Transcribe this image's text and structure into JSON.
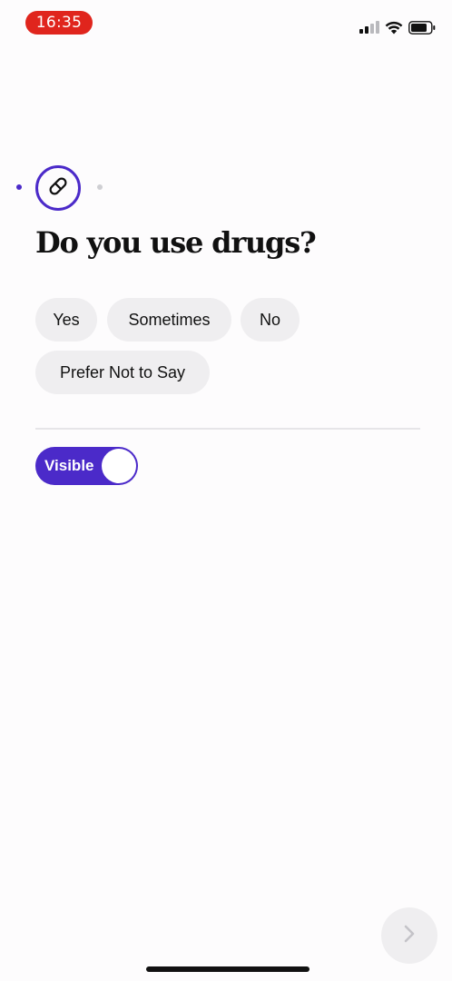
{
  "status_bar": {
    "time": "16:35",
    "time_pill_color": "#e0251d",
    "icons": [
      "cellular-signal-icon",
      "wifi-icon",
      "battery-icon"
    ]
  },
  "progress": {
    "current_step_icon": "pill-icon",
    "accent_color": "#4b2ac9"
  },
  "question": {
    "title": "Do you use drugs?"
  },
  "options": [
    {
      "label": "Yes"
    },
    {
      "label": "Sometimes"
    },
    {
      "label": "No"
    },
    {
      "label": "Prefer Not to Say"
    }
  ],
  "visibility_toggle": {
    "label": "Visible",
    "state": "on"
  },
  "navigation": {
    "next_icon": "chevron-right-icon"
  }
}
